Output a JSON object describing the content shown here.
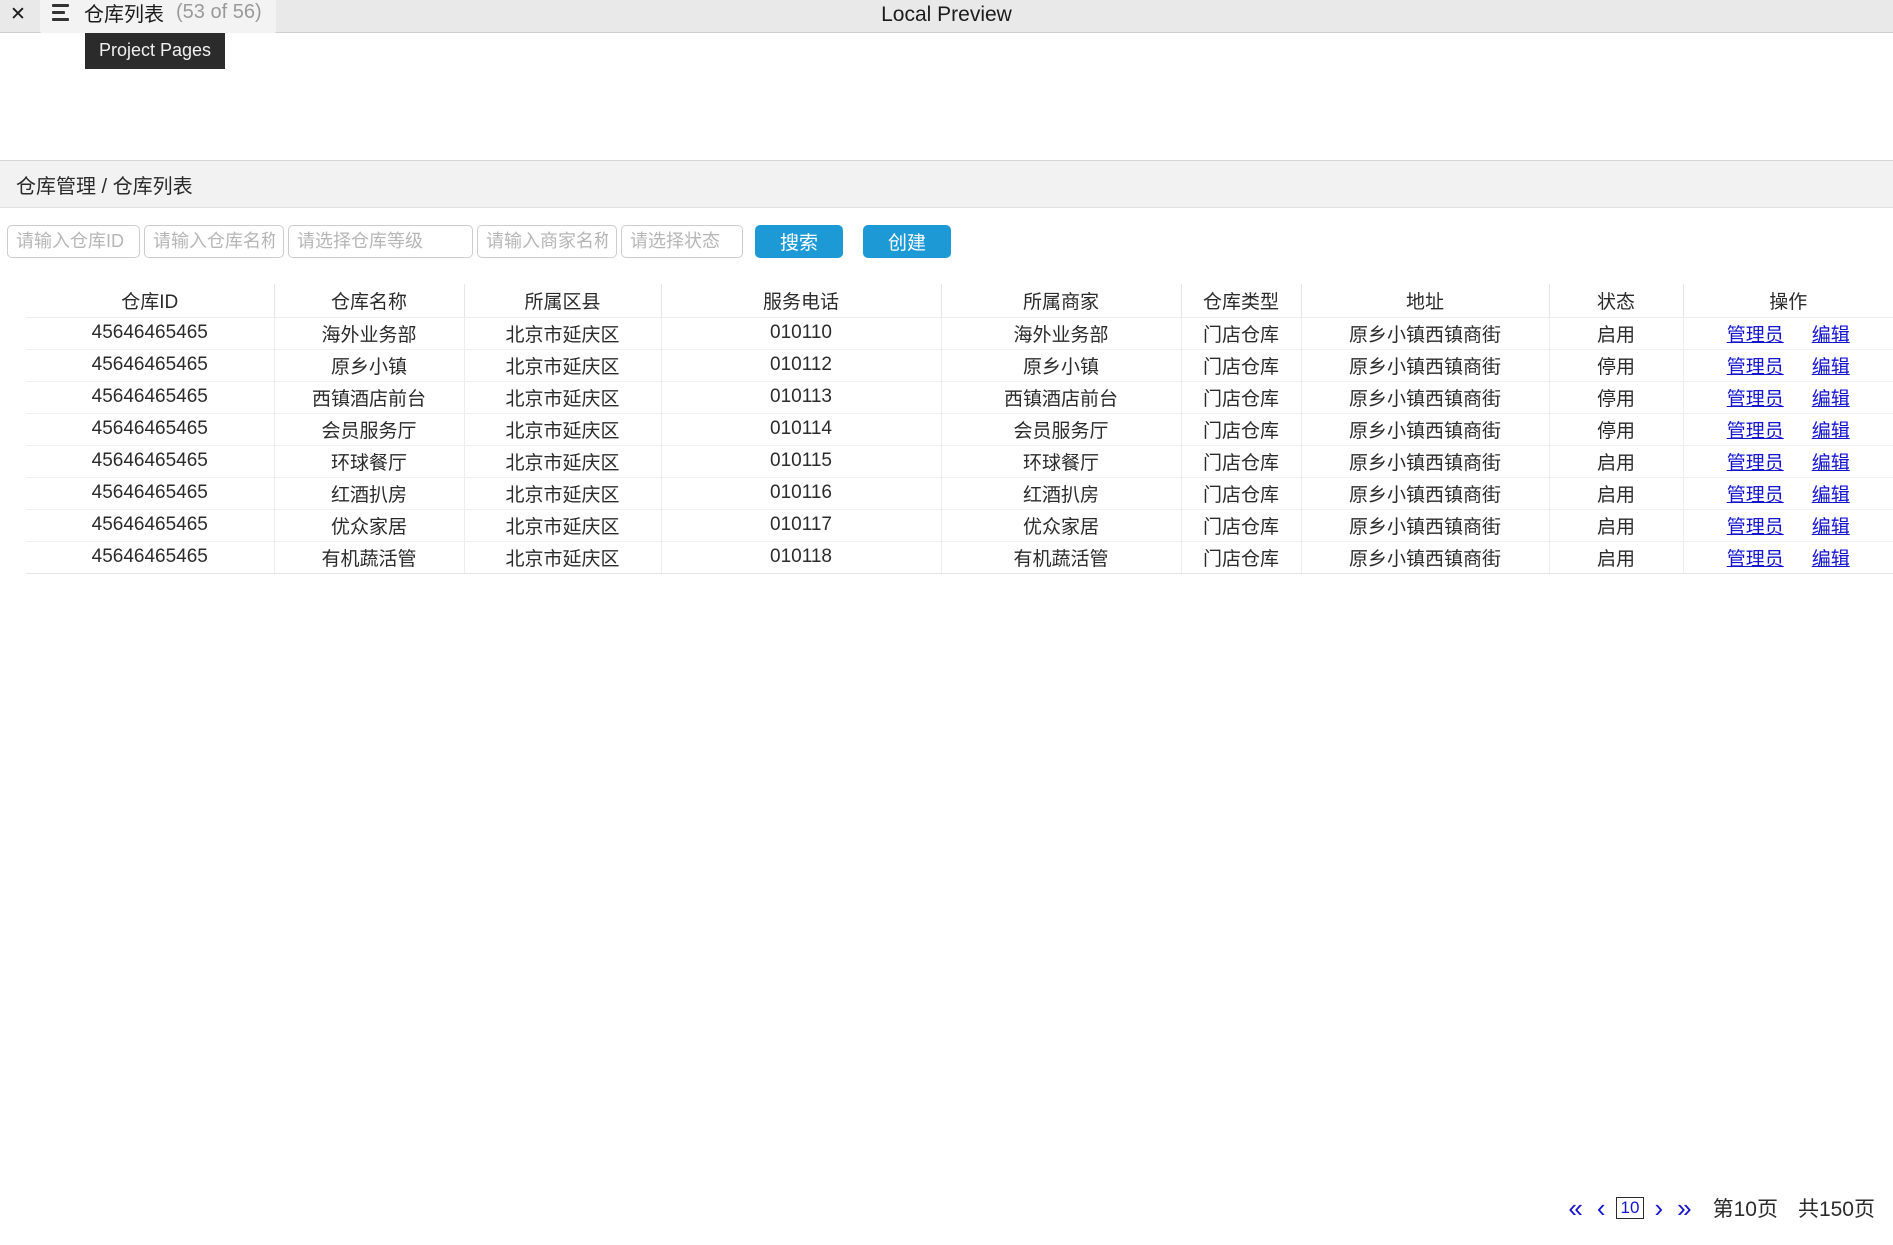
{
  "browser": {
    "close_icon": "close-icon",
    "menu_icon": "hamburger-icon",
    "tab_title": "仓库列表",
    "tab_count": "(53 of 56)",
    "preview_label": "Local Preview",
    "tooltip": "Project Pages"
  },
  "page": {
    "breadcrumb": "仓库管理 / 仓库列表"
  },
  "filters": {
    "warehouse_id_placeholder": "请输入仓库ID",
    "warehouse_id_value": "",
    "warehouse_name_placeholder": "请输入仓库名称",
    "warehouse_name_value": "",
    "warehouse_level_placeholder": "请选择仓库等级",
    "warehouse_level_value": "",
    "merchant_name_placeholder": "请输入商家名称",
    "merchant_name_value": "",
    "status_placeholder": "请选择状态",
    "status_value": "",
    "search_label": "搜索",
    "create_label": "创建",
    "button_color": "#1d9ad6"
  },
  "table": {
    "columns": [
      "仓库ID",
      "仓库名称",
      "所属区县",
      "服务电话",
      "所属商家",
      "仓库类型",
      "地址",
      "状态",
      "操作"
    ],
    "action_labels": {
      "admin": "管理员",
      "edit": "编辑"
    },
    "link_color": "#1414cf",
    "rows": [
      {
        "id": "45646465465",
        "name": "海外业务部",
        "region": "北京市延庆区",
        "phone": "010110",
        "merchant": "海外业务部",
        "type": "门店仓库",
        "address": "原乡小镇西镇商街",
        "status": "启用"
      },
      {
        "id": "45646465465",
        "name": "原乡小镇",
        "region": "北京市延庆区",
        "phone": "010112",
        "merchant": "原乡小镇",
        "type": "门店仓库",
        "address": "原乡小镇西镇商街",
        "status": "停用"
      },
      {
        "id": "45646465465",
        "name": "西镇酒店前台",
        "region": "北京市延庆区",
        "phone": "010113",
        "merchant": "西镇酒店前台",
        "type": "门店仓库",
        "address": "原乡小镇西镇商街",
        "status": "停用"
      },
      {
        "id": "45646465465",
        "name": "会员服务厅",
        "region": "北京市延庆区",
        "phone": "010114",
        "merchant": "会员服务厅",
        "type": "门店仓库",
        "address": "原乡小镇西镇商街",
        "status": "停用"
      },
      {
        "id": "45646465465",
        "name": "环球餐厅",
        "region": "北京市延庆区",
        "phone": "010115",
        "merchant": "环球餐厅",
        "type": "门店仓库",
        "address": "原乡小镇西镇商街",
        "status": "启用"
      },
      {
        "id": "45646465465",
        "name": "红酒扒房",
        "region": "北京市延庆区",
        "phone": "010116",
        "merchant": "红酒扒房",
        "type": "门店仓库",
        "address": "原乡小镇西镇商街",
        "status": "启用"
      },
      {
        "id": "45646465465",
        "name": "优众家居",
        "region": "北京市延庆区",
        "phone": "010117",
        "merchant": "优众家居",
        "type": "门店仓库",
        "address": "原乡小镇西镇商街",
        "status": "启用"
      },
      {
        "id": "45646465465",
        "name": "有机蔬活管",
        "region": "北京市延庆区",
        "phone": "010118",
        "merchant": "有机蔬活管",
        "type": "门店仓库",
        "address": "原乡小镇西镇商街",
        "status": "启用"
      }
    ]
  },
  "pagination": {
    "first": "«",
    "prev": "‹",
    "current": "10",
    "next": "›",
    "last": "»",
    "current_page_text": "第10页",
    "total_pages_text": "共150页"
  }
}
